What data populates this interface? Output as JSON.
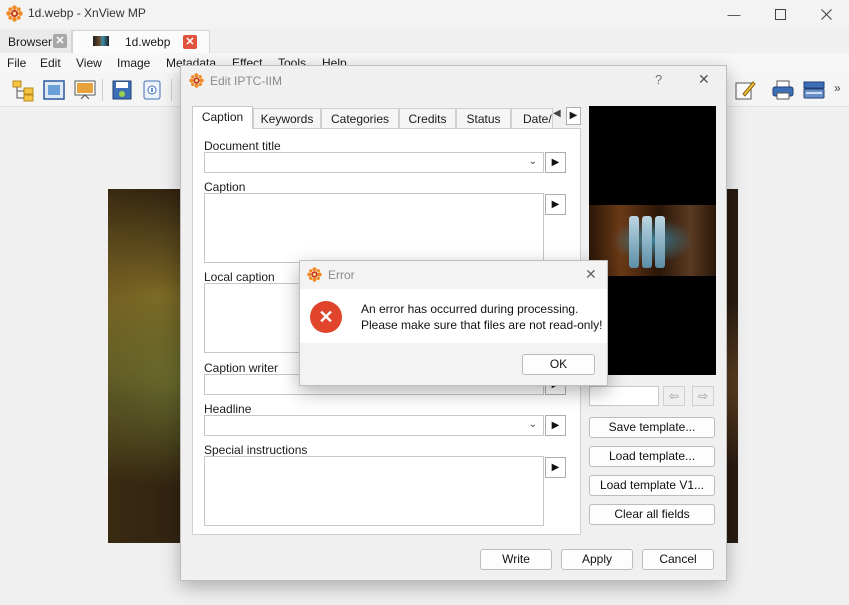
{
  "window": {
    "title": "1d.webp - XnView MP"
  },
  "tabs": [
    {
      "label": "Browser"
    },
    {
      "label": "1d.webp"
    }
  ],
  "menu": [
    "File",
    "Edit",
    "View",
    "Image",
    "Metadata",
    "Effect",
    "Tools",
    "Help"
  ],
  "toolbar": {
    "left_icons": [
      "folder-tree-icon",
      "fit-window-icon",
      "slideshow-icon",
      "save-icon",
      "properties-icon"
    ],
    "right_icons": [
      "edit-pen-icon",
      "print-icon",
      "scanner-icon"
    ],
    "more_label": "»"
  },
  "iptc_dialog": {
    "title": "Edit IPTC-IIM",
    "help_label": "?",
    "close_label": "✕",
    "tabs": [
      "Caption",
      "Keywords",
      "Categories",
      "Credits",
      "Status",
      "Date/"
    ],
    "active_tab": "Caption",
    "tab_scroll_left": "◀",
    "tab_scroll_right": "▶",
    "arrow": "▶",
    "chevron": "⌄",
    "fields": {
      "document_title": {
        "label": "Document title",
        "value": ""
      },
      "caption": {
        "label": "Caption",
        "value": ""
      },
      "local_caption": {
        "label": "Local caption",
        "value": ""
      },
      "caption_writer": {
        "label": "Caption writer",
        "value": ""
      },
      "headline": {
        "label": "Headline",
        "value": ""
      },
      "special_instructions": {
        "label": "Special instructions",
        "value": ""
      }
    },
    "preview_nav": {
      "prev": "⇦",
      "next": "⇨",
      "value": ""
    },
    "side_buttons": [
      "Save template...",
      "Load template...",
      "Load template V1...",
      "Clear all fields"
    ],
    "footer_buttons": [
      "Write",
      "Apply",
      "Cancel"
    ]
  },
  "error_dialog": {
    "title": "Error",
    "close_label": "✕",
    "icon_glyph": "✕",
    "message_line1": "An error has occurred during processing.",
    "message_line2": "Please make sure that files are not read-only!",
    "ok_label": "OK"
  },
  "colors": {
    "accent_error": "#e0452c",
    "tab_close_active": "#e2533d",
    "logo_orange": "#f08a24"
  }
}
